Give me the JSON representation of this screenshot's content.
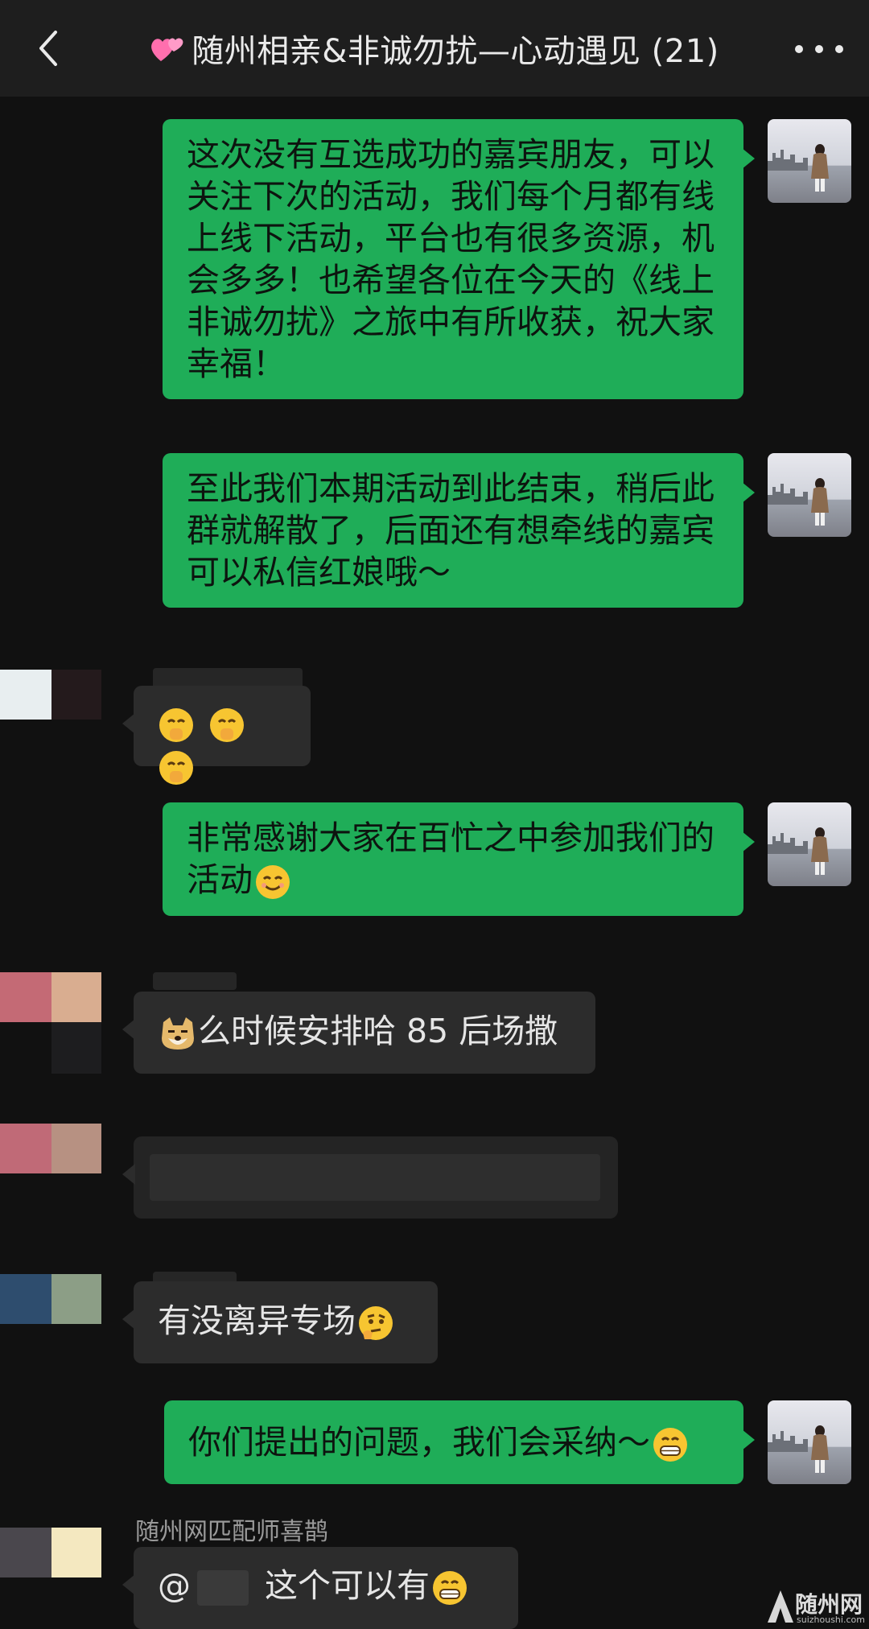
{
  "header": {
    "title": "随州相亲&非诚勿扰—心动遇见 (21)",
    "back_icon": "chevron-left-icon",
    "more_icon": "more-dots-icon",
    "heart_icon": "two-hearts-icon"
  },
  "messages": [
    {
      "side": "out",
      "text": "这次没有互选成功的嘉宾朋友，可以关注下次的活动，我们每个月都有线上线下活动，平台也有很多资源，机会多多！也希望各位在今天的《线上非诚勿扰》之旅中有所收获，祝大家幸福！"
    },
    {
      "side": "out",
      "text": "至此我们本期活动到此结束，稍后此群就解散了，后面还有想牵线的嘉宾可以私信红娘哦～"
    },
    {
      "side": "in",
      "emojis": [
        "shush-face-icon",
        "shush-face-icon",
        "shush-face-icon"
      ]
    },
    {
      "side": "out",
      "text": "非常感谢大家在百忙之中参加我们的活动",
      "emoji": "smiling-face-icon"
    },
    {
      "side": "in",
      "emoji": "doge-icon",
      "text": "么时候安排哈 85 后场撒"
    },
    {
      "side": "in",
      "text": "",
      "note": "blurred"
    },
    {
      "side": "in",
      "text": "有没离异专场",
      "emoji": "thinking-face-icon"
    },
    {
      "side": "out",
      "text": "你们提出的问题，我们会采纳～",
      "emoji": "grinning-face-icon"
    },
    {
      "side": "in",
      "sender": "随州网匹配师喜鹊",
      "prefix": "@",
      "text": "这个可以有",
      "emoji": "grinning-face-icon"
    }
  ],
  "watermark": {
    "title": "随州网",
    "subtitle": "suizhoushi.com"
  },
  "colors": {
    "outgoing_bubble": "#1fad58",
    "incoming_bubble": "#2c2c2c",
    "background": "#111111",
    "header": "#1e1e1e"
  }
}
